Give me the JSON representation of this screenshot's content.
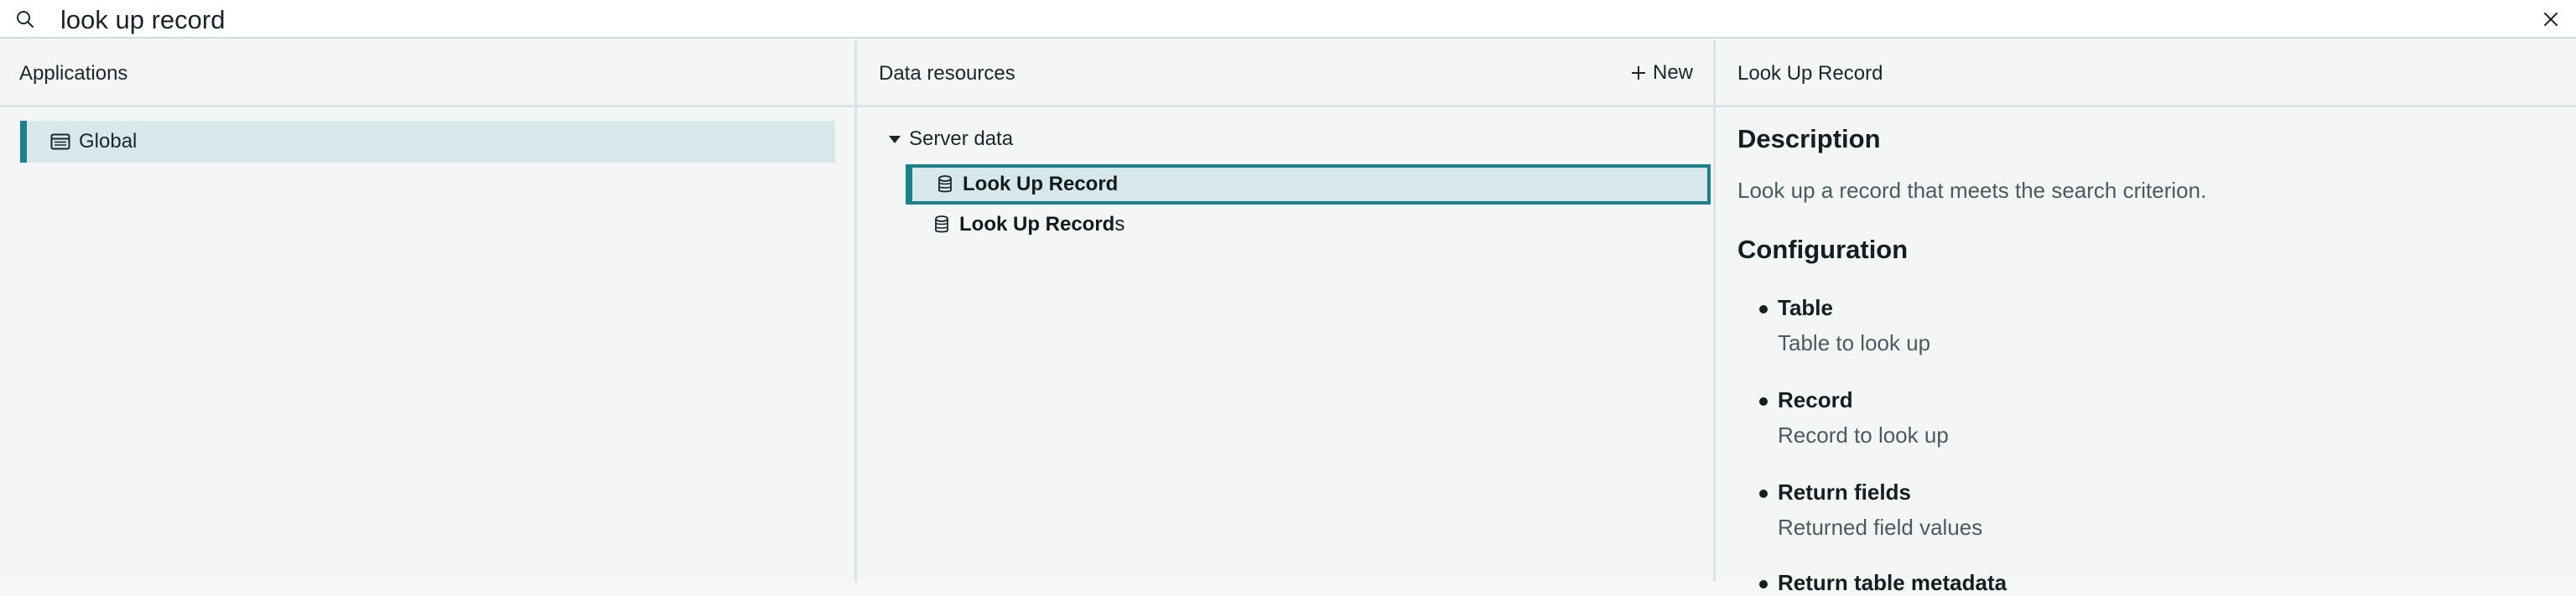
{
  "search": {
    "query": "look up record"
  },
  "applications": {
    "header": "Applications",
    "items": [
      {
        "label": "Global",
        "icon": "app-window-icon",
        "selected": true
      }
    ]
  },
  "data_resources": {
    "header": "Data resources",
    "new_label": "New",
    "group": {
      "label": "Server data",
      "expanded": true
    },
    "items": [
      {
        "label_bold": "Look Up Record",
        "label_rest": "",
        "selected": true
      },
      {
        "label_bold": "Look Up Record",
        "label_rest": "s",
        "selected": false
      }
    ]
  },
  "details": {
    "header": "Look Up Record",
    "description_heading": "Description",
    "description_text": "Look up a record that meets the search criterion.",
    "configuration_heading": "Configuration",
    "fields": [
      {
        "name": "Table",
        "desc": "Table to look up"
      },
      {
        "name": "Record",
        "desc": "Record to look up"
      },
      {
        "name": "Return fields",
        "desc": "Returned field values"
      },
      {
        "name": "Return table metadata",
        "desc": ""
      }
    ]
  },
  "colors": {
    "accent": "#1c7f8c",
    "selection_bg": "#d8e8ea",
    "panel_bg": "#f4f6f5"
  }
}
